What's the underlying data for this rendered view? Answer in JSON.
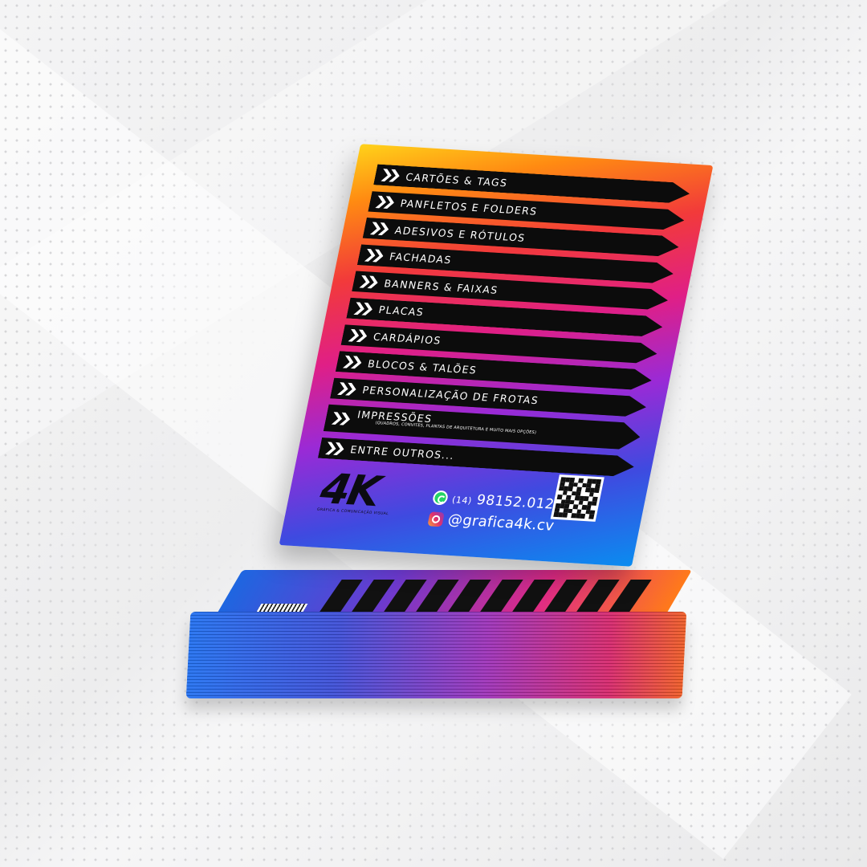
{
  "flyer": {
    "menu": [
      "CARTÕES & TAGS",
      "PANFLETOS E FOLDERS",
      "ADESIVOS E RÓTULOS",
      "FACHADAS",
      "BANNERS & FAIXAS",
      "PLACAS",
      "CARDÁPIOS",
      "BLOCOS & TALÕES",
      "PERSONALIZAÇÃO DE FROTAS",
      "IMPRESSÕES",
      "ENTRE OUTROS..."
    ],
    "impressoes_sub": "(QUADROS, CONVITES, PLANTAS DE ARQUITETURA E MUITO MAIS OPÇÕES)",
    "brand": "4K",
    "brand_sub": "GRÁFICA & COMUNICAÇÃO VISUAL",
    "phone_prefix": "(14)",
    "phone": "98152.0127",
    "instagram": "@grafica4k.cv",
    "icons": [
      "chevron-double-icon",
      "whatsapp-icon",
      "instagram-icon",
      "qr-code"
    ],
    "colors": {
      "gradient_top": "#ffd21a",
      "gradient_mid": "#e01f86",
      "gradient_bottom": "#0a8cf0",
      "band": "#0c0c0c"
    }
  }
}
